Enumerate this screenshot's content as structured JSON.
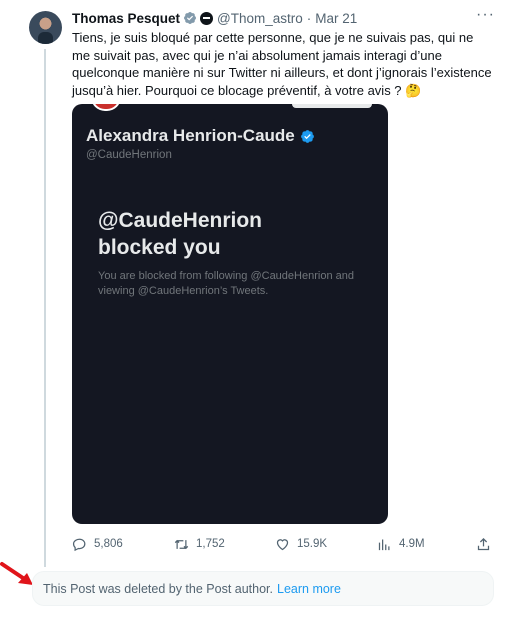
{
  "tweet": {
    "author_name": "Thomas Pesquet",
    "handle": "@Thom_astro",
    "separator": "·",
    "date": "Mar 21",
    "text": "Tiens, je suis bloqué par cette personne, que je ne suivais pas, qui ne me suivait pas, avec qui je n’ai absolument jamais interagi d’une quelconque manière ni sur Twitter ni ailleurs, et dont j’ignorais l’existence jusqu’à hier. Pourquoi ce blocage préventif, à votre avis ? 🤔",
    "more_icon": "more-horizontal-icon"
  },
  "media": {
    "profile_name": "Alexandra Henrion-Caude",
    "profile_handle": "@CaudeHenrion",
    "headline_line1": "@CaudeHenrion",
    "headline_line2": "blocked you",
    "subtext": "You are blocked from following @CaudeHenrion and viewing @CaudeHenrion’s Tweets."
  },
  "actions": {
    "replies": "5,806",
    "retweets": "1,752",
    "likes": "15.9K",
    "views": "4.9M"
  },
  "notice": {
    "text": "This Post was deleted by the Post author.",
    "link": "Learn more"
  },
  "colors": {
    "accent": "#1d9bf0",
    "media_bg": "#141722",
    "arrow": "#e0141a",
    "muted": "#536471"
  }
}
